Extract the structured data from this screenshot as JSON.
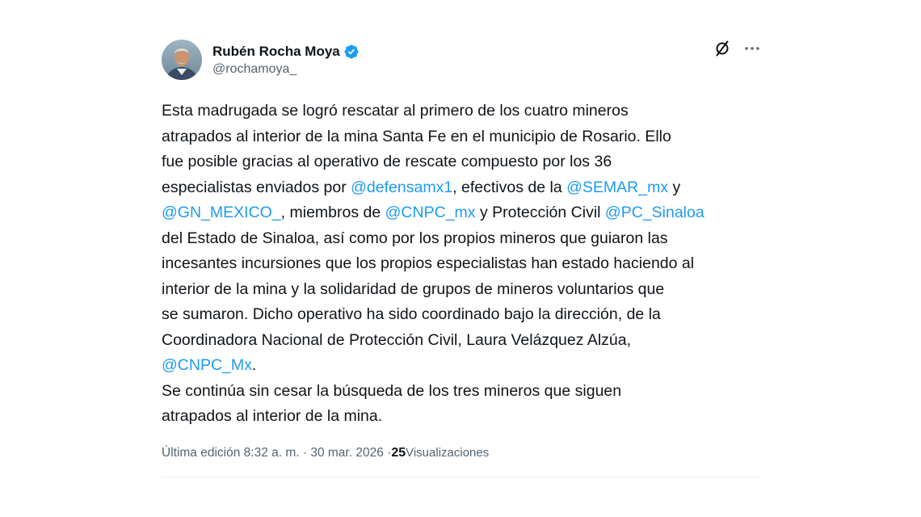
{
  "author": {
    "display_name": "Rubén Rocha Moya",
    "handle": "@rochamoya_",
    "verified": true,
    "avatar_icon": "user-photo"
  },
  "actions": {
    "grok_icon": "grok-icon",
    "more_icon": "more-options-icon"
  },
  "tweet": {
    "segments": [
      {
        "t": "Esta madrugada se logró rescatar al primero de los cuatro mineros"
      },
      {
        "br": true
      },
      {
        "t": "atrapados al interior de la mina Santa Fe en el municipio de Rosario. Ello"
      },
      {
        "br": true
      },
      {
        "t": "fue posible gracias al operativo de rescate compuesto por los 36"
      },
      {
        "br": true
      },
      {
        "t": "especialistas enviados por "
      },
      {
        "m": "@defensamx1"
      },
      {
        "t": ", efectivos de la "
      },
      {
        "m": "@SEMAR_mx"
      },
      {
        "t": " y"
      },
      {
        "br": true
      },
      {
        "m": "@GN_MEXICO_"
      },
      {
        "t": ", miembros de "
      },
      {
        "m": "@CNPC_mx"
      },
      {
        "t": " y Protección Civil "
      },
      {
        "m": "@PC_Sinaloa"
      },
      {
        "br": true
      },
      {
        "t": "del Estado de Sinaloa, así como por los propios mineros que guiaron las"
      },
      {
        "br": true
      },
      {
        "t": "incesantes incursiones que los propios especialistas han estado haciendo al"
      },
      {
        "br": true
      },
      {
        "t": "interior de la mina y la solidaridad de grupos de mineros voluntarios que"
      },
      {
        "br": true
      },
      {
        "t": "se sumaron. Dicho operativo ha sido coordinado bajo la dirección, de la"
      },
      {
        "br": true
      },
      {
        "t": "Coordinadora Nacional de Protección Civil, Laura Velázquez Alzúa,"
      },
      {
        "br": true
      },
      {
        "m": "@CNPC_Mx"
      },
      {
        "t": "."
      },
      {
        "br": true
      },
      {
        "t": "Se continúa sin cesar la búsqueda de los tres mineros que siguen"
      },
      {
        "br": true
      },
      {
        "t": "atrapados al interior de la mina."
      }
    ]
  },
  "meta": {
    "edited_label": "Última edición 8:32 a. m. · 30 mar. 2026 · ",
    "views_count": "25",
    "views_label": " Visualizaciones"
  },
  "colors": {
    "link": "#1d9bf0",
    "text": "#0f1419",
    "secondary": "#536471",
    "verified": "#1d9bf0"
  }
}
